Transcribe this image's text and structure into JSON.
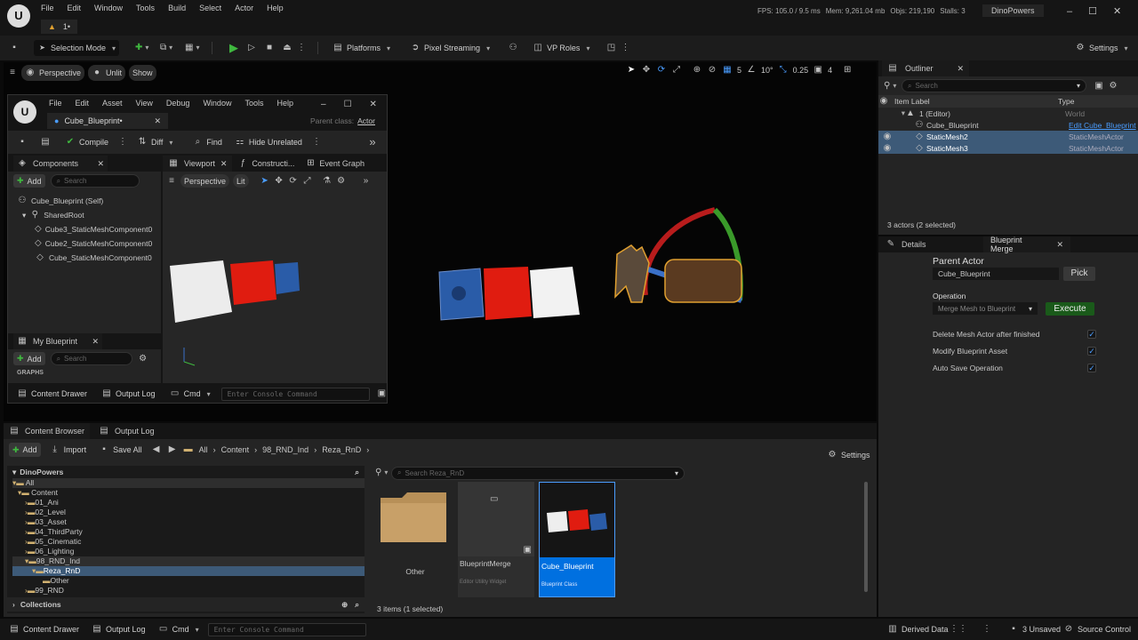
{
  "app": {
    "menu": [
      "File",
      "Edit",
      "Window",
      "Tools",
      "Build",
      "Select",
      "Actor",
      "Help"
    ],
    "tab_label": "1•",
    "stats": {
      "fps": "FPS: 105.0 / 9.5 ms",
      "mem": "Mem: 9,261.04 mb",
      "objs": "Objs: 219,190",
      "stalls": "Stalls: 3"
    },
    "project": "DinoPowers"
  },
  "toolbar": {
    "selection_mode": "Selection Mode",
    "platforms": "Platforms",
    "pixel_streaming": "Pixel Streaming",
    "vp_roles": "VP Roles",
    "settings": "Settings"
  },
  "viewport": {
    "perspective": "Perspective",
    "unlit": "Unlit",
    "show": "Show",
    "grid_size": "5",
    "rot_snap": "10°",
    "scale_snap": "0.25",
    "cam_speed": "4"
  },
  "bp_editor": {
    "menu": [
      "File",
      "Edit",
      "Asset",
      "View",
      "Debug",
      "Window",
      "Tools",
      "Help"
    ],
    "tab": "Cube_Blueprint•",
    "parent_class_label": "Parent class:",
    "parent_class_value": "Actor",
    "toolbar": {
      "compile": "Compile",
      "diff": "Diff",
      "find": "Find",
      "hide_unrelated": "Hide Unrelated"
    },
    "components": {
      "title": "Components",
      "add": "Add",
      "search": "Search",
      "items": [
        "Cube_Blueprint (Self)",
        "SharedRoot",
        "Cube3_StaticMeshComponent0",
        "Cube2_StaticMeshComponent0",
        "Cube_StaticMeshComponent0"
      ]
    },
    "tabs": [
      "Viewport",
      "Constructi...",
      "Event Graph"
    ],
    "vp": {
      "perspective": "Perspective",
      "lit": "Lit"
    },
    "my_blueprint": {
      "title": "My Blueprint",
      "add": "Add",
      "search": "Search",
      "graphs": "GRAPHS"
    },
    "bottom": {
      "content_drawer": "Content Drawer",
      "output_log": "Output Log",
      "cmd": "Cmd",
      "console": "Enter Console Command"
    }
  },
  "outliner": {
    "title": "Outliner",
    "search": "Search",
    "col_label": "Item Label",
    "col_type": "Type",
    "rows": [
      {
        "label": "1 (Editor)",
        "type": "World"
      },
      {
        "label": "Cube_Blueprint",
        "type": "Edit Cube_Blueprint"
      },
      {
        "label": "StaticMesh2",
        "type": "StaticMeshActor"
      },
      {
        "label": "StaticMesh3",
        "type": "StaticMeshActor"
      }
    ],
    "status": "3 actors (2 selected)"
  },
  "details": {
    "tab_details": "Details",
    "tab_merge": "Blueprint Merge",
    "parent_actor_label": "Parent Actor",
    "parent_actor_value": "Cube_Blueprint",
    "pick": "Pick",
    "operation_label": "Operation",
    "operation_value": "Merge Mesh to Blueprint",
    "execute": "Execute",
    "options": [
      {
        "label": "Delete Mesh Actor after finished",
        "checked": true
      },
      {
        "label": "Modify Blueprint Asset",
        "checked": true
      },
      {
        "label": "Auto Save Operation",
        "checked": true
      }
    ]
  },
  "content_browser": {
    "tab": "Content Browser",
    "tab2": "Output Log",
    "add": "Add",
    "import": "Import",
    "save_all": "Save All",
    "path": [
      "All",
      "Content",
      "98_RND_Ind",
      "Reza_RnD"
    ],
    "settings": "Settings",
    "search": "Search Reza_RnD",
    "root": "DinoPowers",
    "tree": [
      "All",
      "Content",
      "01_Ani",
      "02_Level",
      "03_Asset",
      "04_ThirdParty",
      "05_Cinematic",
      "06_Lighting",
      "98_RND_Ind",
      "Reza_RnD",
      "Other",
      "99_RND"
    ],
    "collections": "Collections",
    "assets": [
      {
        "name": "Other",
        "sub": ""
      },
      {
        "name": "BlueprintMerge",
        "sub": "Editor Utility Widget"
      },
      {
        "name": "Cube_Blueprint",
        "sub": "Blueprint Class"
      }
    ],
    "status": "3 items (1 selected)"
  },
  "statusbar": {
    "content_drawer": "Content Drawer",
    "output_log": "Output Log",
    "cmd": "Cmd",
    "console": "Enter Console Command",
    "derived": "Derived Data",
    "unsaved": "3 Unsaved",
    "source": "Source Control"
  },
  "colors": {
    "accent": "#0070e0",
    "selected_row": "#3d5a78",
    "green": "#3fb83f"
  }
}
